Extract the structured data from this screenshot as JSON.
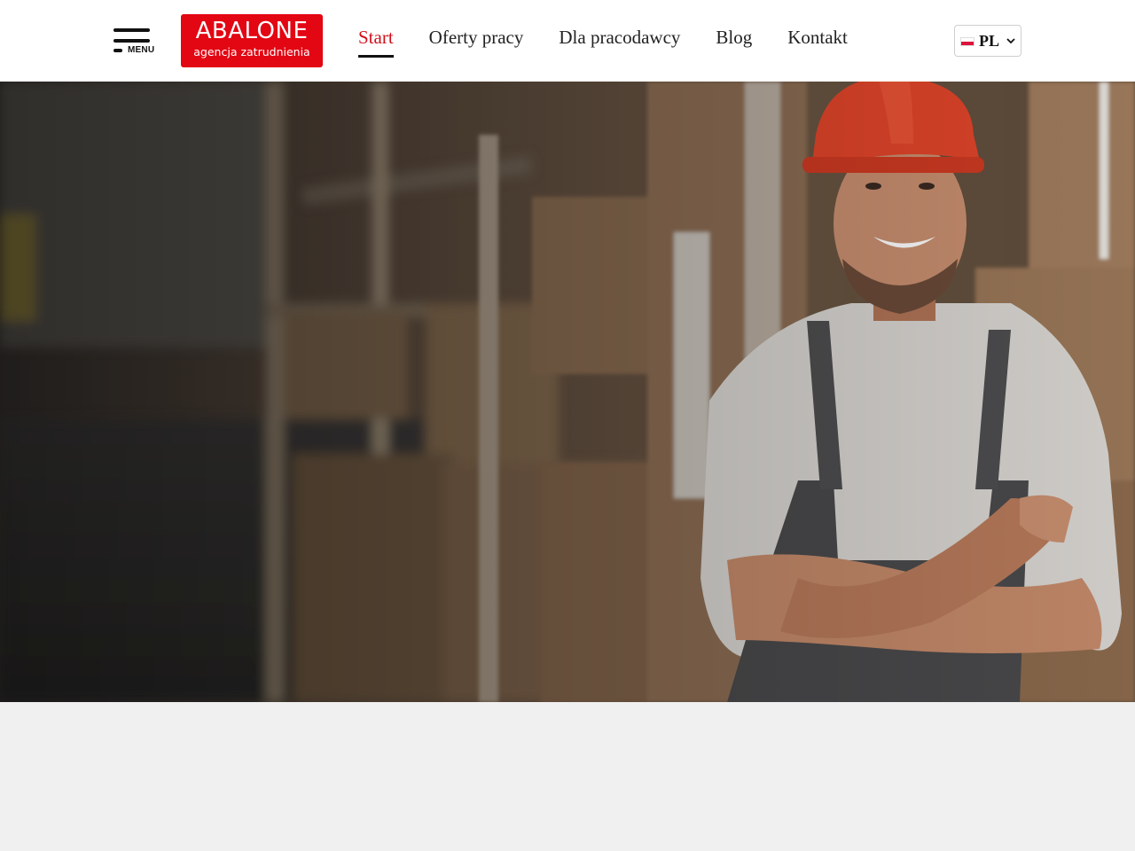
{
  "header": {
    "menu_label": "MENU",
    "logo": {
      "wordmark": "ABALONE",
      "tagline": "agencja zatrudnienia",
      "brand_color": "#e30613"
    },
    "nav": [
      {
        "label": "Start",
        "active": true
      },
      {
        "label": "Oferty pracy",
        "active": false
      },
      {
        "label": "Dla pracodawcy",
        "active": false
      },
      {
        "label": "Blog",
        "active": false
      },
      {
        "label": "Kontakt",
        "active": false
      }
    ],
    "language": {
      "code": "PL",
      "flag_icon": "poland-flag-icon"
    }
  },
  "colors": {
    "accent": "#d0111b",
    "header_bg": "#ffffff",
    "below_bg": "#f0f0f0"
  },
  "hero": {
    "image": "warehouse worker in orange hard hat with crossed arms"
  }
}
